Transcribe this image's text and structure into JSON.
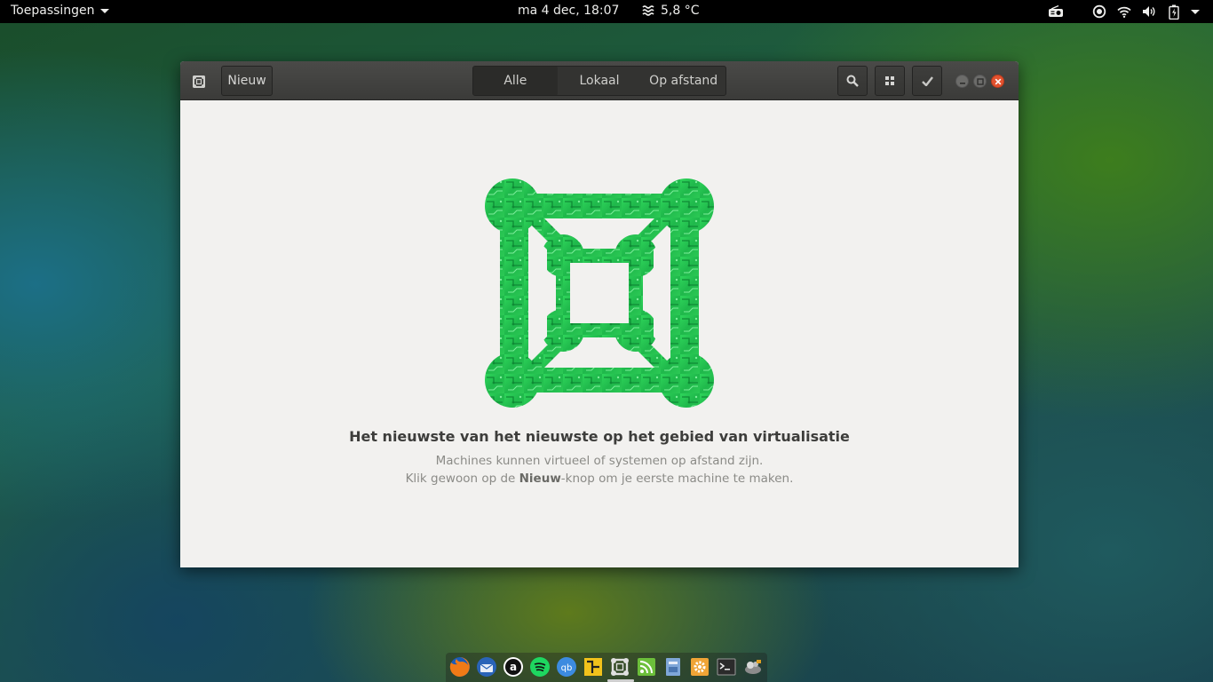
{
  "topbar": {
    "apps_label": "Toepassingen",
    "clock": "ma  4 dec, 18:07",
    "weather": "5,8 °C",
    "tray_icons": [
      "radio-icon",
      "record-icon",
      "wifi-icon",
      "volume-icon",
      "battery-icon",
      "system-menu-caret"
    ]
  },
  "window": {
    "new_button": "Nieuw",
    "tabs": [
      "Alle",
      "Lokaal",
      "Op afstand"
    ],
    "active_tab": "Alle",
    "buttons": [
      "search-icon",
      "grid-view-icon",
      "selection-mode-icon"
    ],
    "controls": [
      "minimize",
      "maximize",
      "close"
    ]
  },
  "empty_state": {
    "title": "Het nieuwste van het nieuwste op het gebied van virtualisatie",
    "line1": "Machines kunnen virtueel of systemen op afstand zijn.",
    "line2_before": "Klik gewoon op de ",
    "line2_bold": "Nieuw",
    "line2_after": "-knop om je eerste machine te maken."
  },
  "dock": {
    "apps": [
      "firefox",
      "thunderbird",
      "amazon",
      "spotify",
      "qbittorrent",
      "network-tool",
      "boxes",
      "feed-reader",
      "file-manager",
      "system-settings",
      "terminal",
      "gnome-tweak"
    ]
  },
  "colors": {
    "accent_green": "#2fd55b",
    "close_red": "#e3522f",
    "window_bg": "#f2f1ef"
  }
}
